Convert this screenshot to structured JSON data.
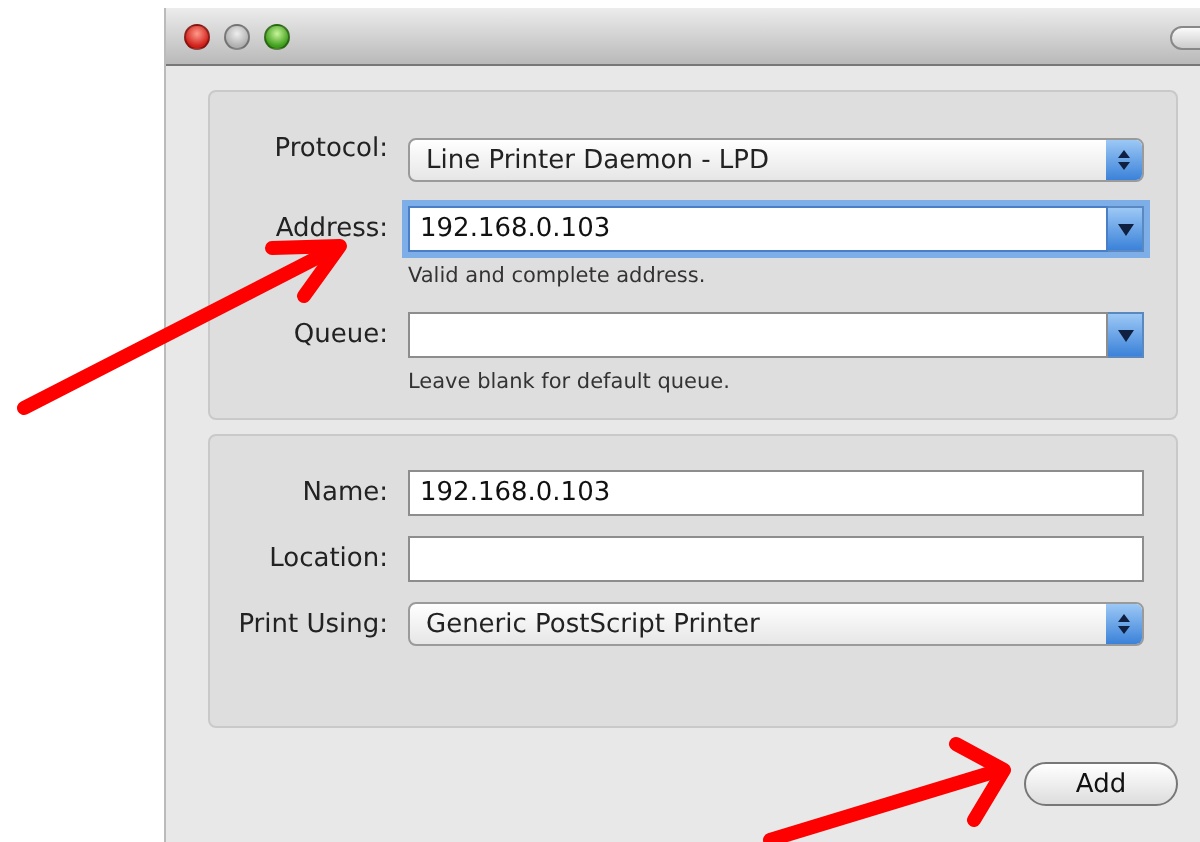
{
  "window": {
    "controls": [
      {
        "kind": "close"
      },
      {
        "kind": "minimize"
      },
      {
        "kind": "zoom"
      }
    ]
  },
  "groups": [
    {
      "fields": [
        {
          "label": "Protocol:",
          "kind": "popup",
          "value": "Line Printer Daemon - LPD"
        },
        {
          "label": "Address:",
          "kind": "combo",
          "value": "192.168.0.103",
          "focused": true,
          "hint": "Valid and complete address."
        },
        {
          "label": "Queue:",
          "kind": "combo",
          "focused": false,
          "hint": "Leave blank for default queue."
        }
      ]
    },
    {
      "fields": [
        {
          "label": "Name:",
          "kind": "text",
          "value": "192.168.0.103",
          "focused": false
        },
        {
          "label": "Location:",
          "kind": "text",
          "focused": false
        },
        {
          "label": "Print Using:",
          "kind": "popup",
          "value": "Generic PostScript Printer"
        }
      ]
    }
  ],
  "buttons": [
    "Add"
  ]
}
